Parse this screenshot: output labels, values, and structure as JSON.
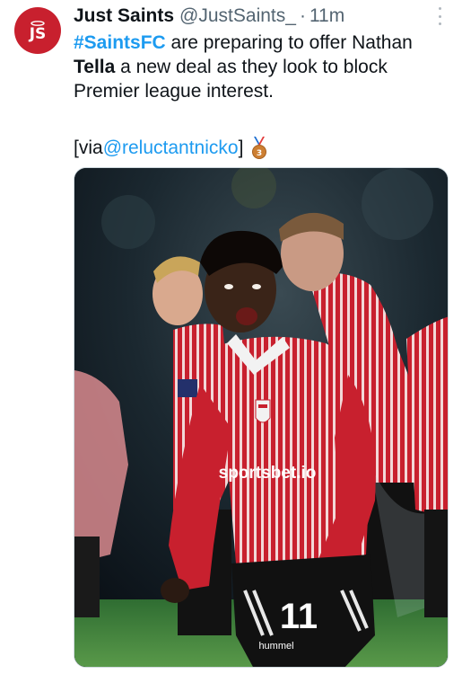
{
  "tweet": {
    "author_name": "Just Saints",
    "author_handle": "@JustSaints_",
    "separator": "·",
    "time": "11m",
    "avatar_initials": "JS",
    "text": {
      "hashtag": "#SaintsFC",
      "line1_rest": " are preparing to offer Nathan",
      "bold_name": "Tella",
      "line2_rest": " a new deal as they look to block",
      "line3": "Premier league interest."
    },
    "via_prefix": "[via ",
    "via_mention": "@reluctantnicko",
    "via_suffix": "]",
    "medal_icon": "3rd-place-medal",
    "media": {
      "sponsor_text": "sportsbet.io",
      "shirt_number": "11",
      "kit_brand": "hummel"
    }
  },
  "colors": {
    "link": "#1d9bf0",
    "secondary_text": "#536471",
    "avatar_bg": "#c8202e",
    "kit_red": "#c8202e"
  }
}
